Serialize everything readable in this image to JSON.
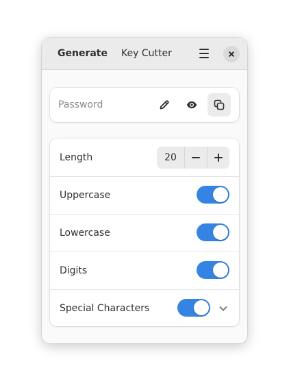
{
  "header": {
    "tabs": [
      {
        "label": "Generate",
        "active": true
      },
      {
        "label": "Key Cutter",
        "active": false
      }
    ],
    "menu_icon": "hamburger-menu-icon",
    "close_icon": "close-icon"
  },
  "password": {
    "placeholder": "Password",
    "value": "",
    "actions": [
      "edit-icon",
      "eye-icon",
      "copy-icon"
    ]
  },
  "options": {
    "length": {
      "label": "Length",
      "value": "20"
    },
    "uppercase": {
      "label": "Uppercase",
      "enabled": true
    },
    "lowercase": {
      "label": "Lowercase",
      "enabled": true
    },
    "digits": {
      "label": "Digits",
      "enabled": true
    },
    "special": {
      "label": "Special Characters",
      "enabled": true,
      "expand_icon": "chevron-down-icon"
    }
  },
  "colors": {
    "accent": "#3584e4",
    "header_bg": "#ebebeb",
    "window_bg": "#fafafa"
  }
}
